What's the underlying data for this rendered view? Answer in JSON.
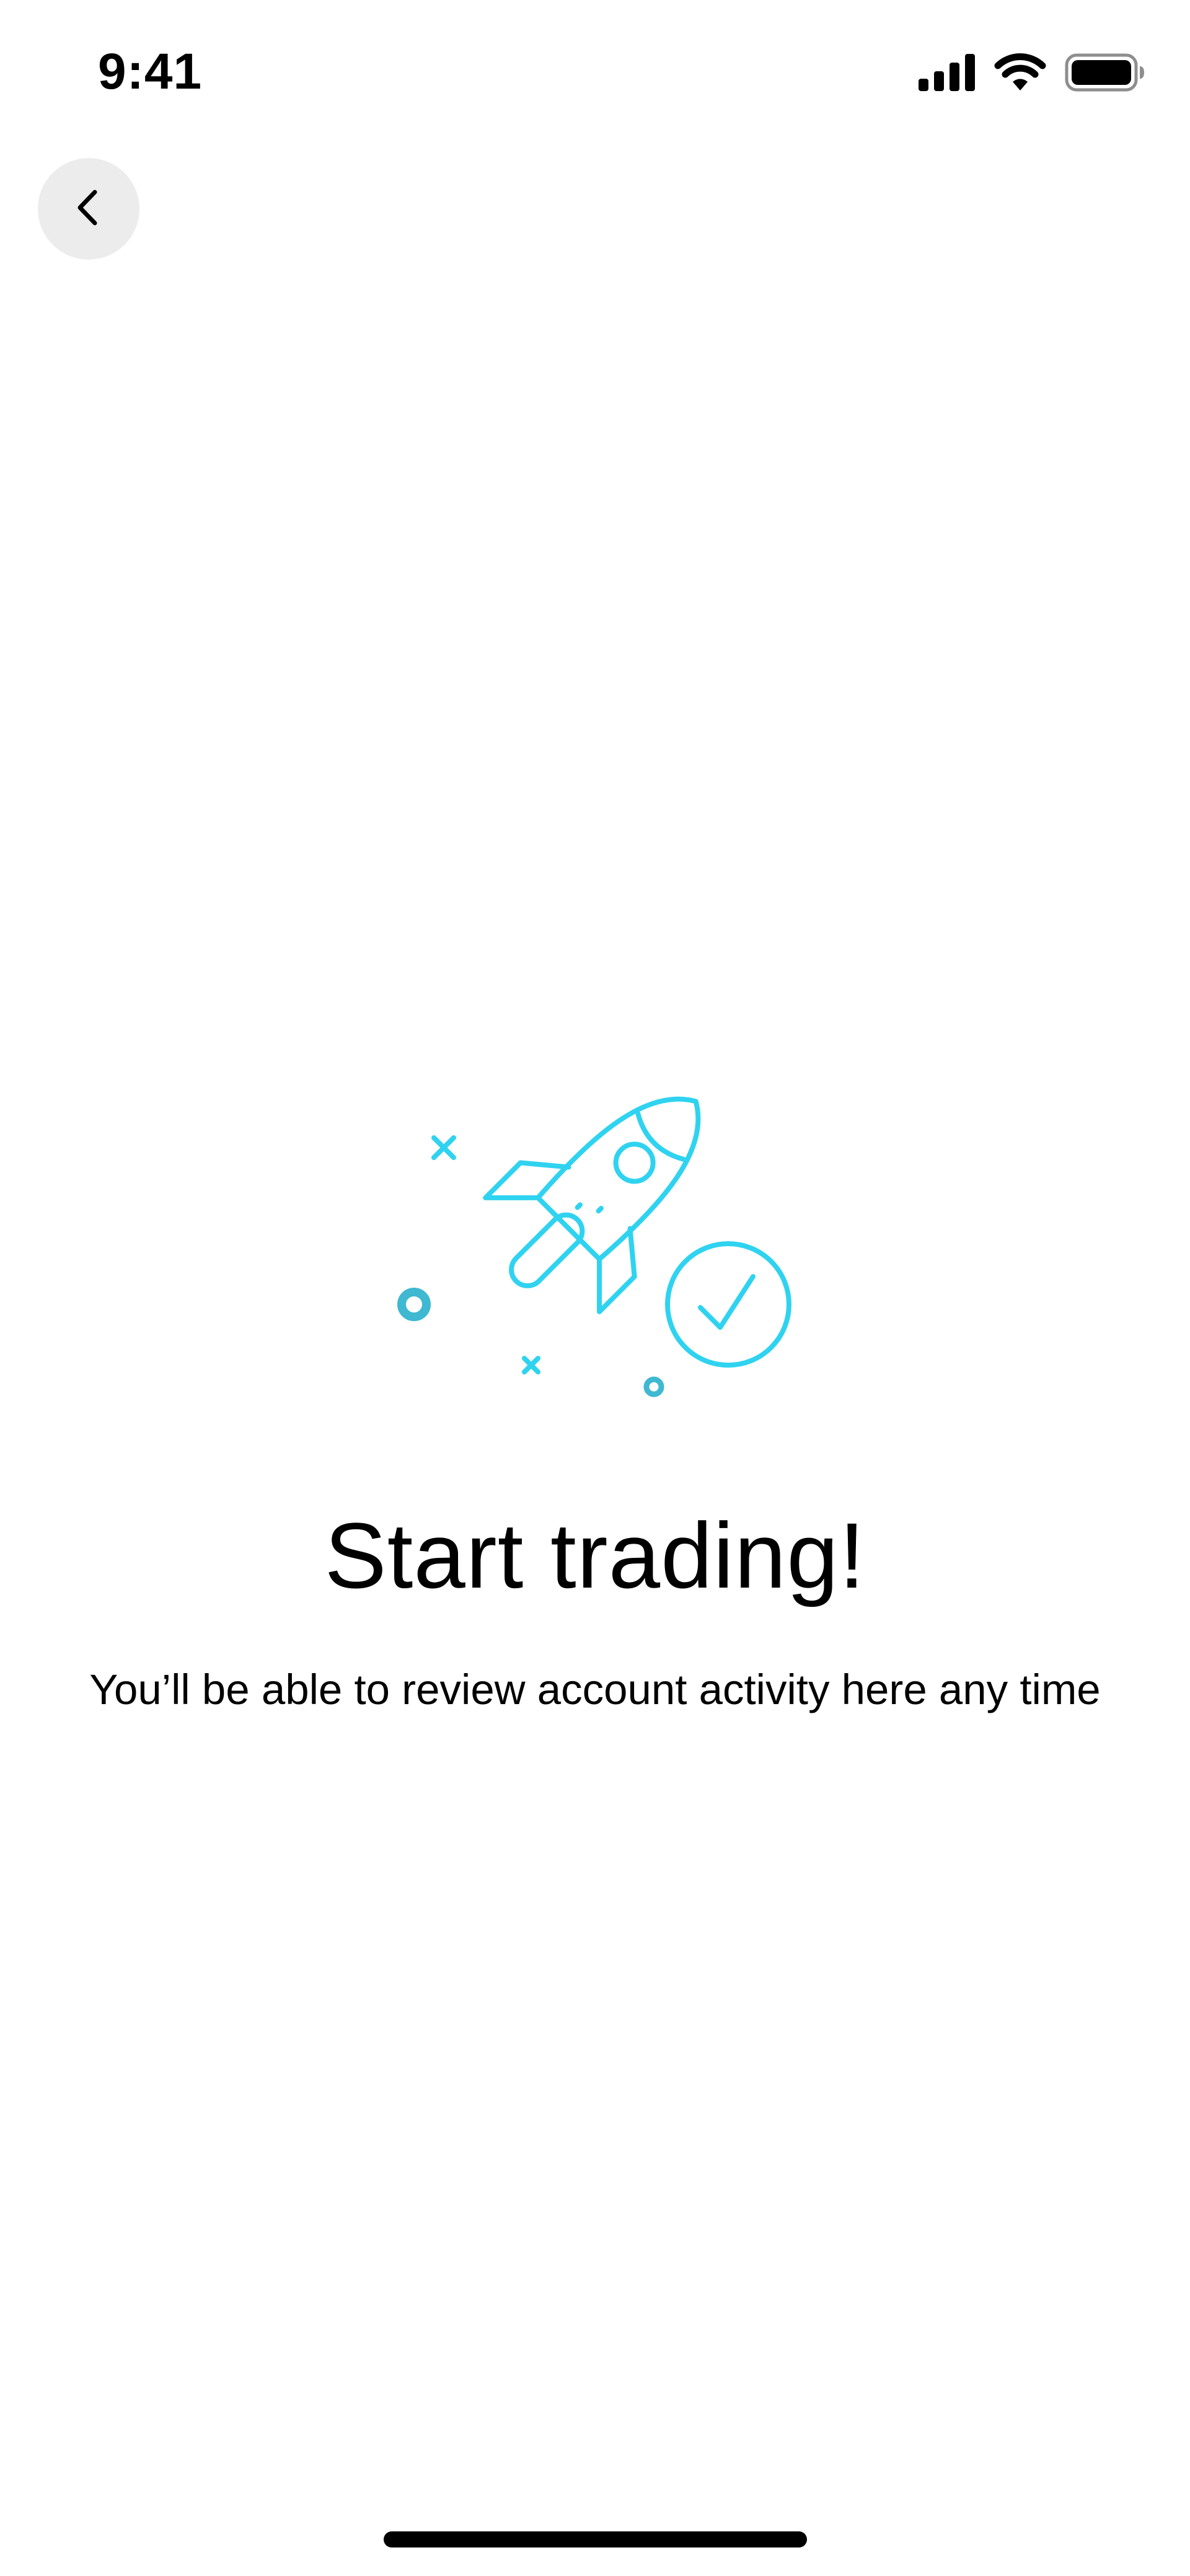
{
  "status_bar": {
    "time": "9:41",
    "icons": [
      "cellular-signal-icon",
      "wifi-icon",
      "battery-icon"
    ]
  },
  "navigation": {
    "back_icon": "chevron-left-icon"
  },
  "illustration": {
    "icon": "rocket-launch-icon",
    "accent_color": "#2fd3f0",
    "dot_color": "#3fb8d2"
  },
  "content": {
    "title": "Start trading!",
    "subtitle": "You’ll be able to review account activity here any time"
  },
  "colors": {
    "background": "#ffffff",
    "text": "#000000",
    "back_button_bg": "#ececec"
  }
}
